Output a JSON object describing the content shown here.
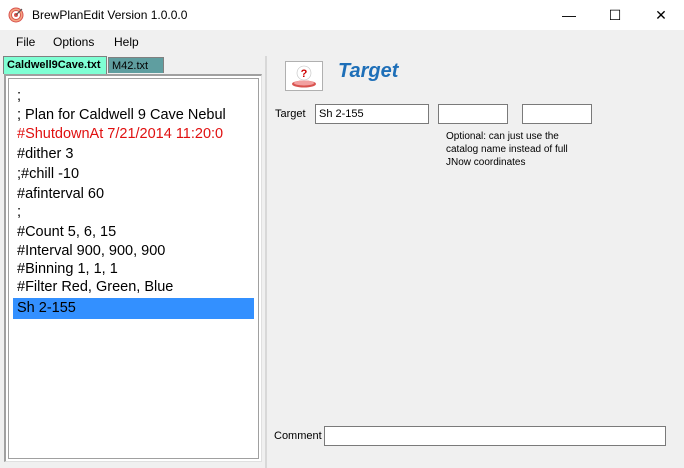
{
  "window": {
    "title": "BrewPlanEdit Version 1.0.0.0",
    "minimize": "—",
    "maximize": "☐",
    "close": "✕"
  },
  "menu": [
    "File",
    "Options",
    "Help"
  ],
  "tabs": [
    {
      "label": "Caldwell9Cave.txt",
      "active": true
    },
    {
      "label": "M42.txt",
      "active": false
    }
  ],
  "editor": {
    "lines": [
      ";",
      "; Plan for Caldwell 9 Cave Nebul",
      "#ShutdownAt  7/21/2014 11:20:0",
      "#dither 3",
      ";#chill -10",
      "#afinterval 60",
      ";",
      "#Count 5, 6, 15",
      "#Interval 900, 900, 900",
      "#Binning 1, 1, 1",
      "#Filter Red, Green, Blue",
      "Sh 2-155"
    ],
    "highlight_color": "#e01010",
    "selection_color": "#3390ff"
  },
  "panel": {
    "heading": "Target",
    "heading_color": "#1e6fb8",
    "help_icon": "question-help-icon",
    "target_label": "Target",
    "target_value": "Sh 2-155",
    "field2_value": "",
    "field3_value": "",
    "hint": "Optional: can just use the catalog name instead of full JNow coordinates",
    "comment_label": "Comment",
    "comment_value": ""
  }
}
